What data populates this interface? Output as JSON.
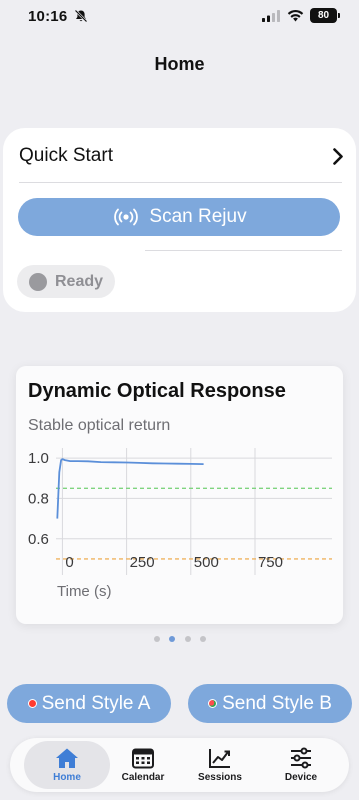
{
  "status_bar": {
    "time": "10:16",
    "battery": "80"
  },
  "header": {
    "title": "Home"
  },
  "quick_start": {
    "title": "Quick Start",
    "scan_button_label": "Scan Rejuv",
    "status": "Ready"
  },
  "chart_card": {
    "title": "Dynamic Optical Response",
    "subtitle": "Stable optical return"
  },
  "chart_data": {
    "type": "line",
    "title": "Dynamic Optical Response",
    "subtitle": "Stable optical return",
    "xlabel": "Time (s)",
    "ylabel": "",
    "xlim": [
      -25,
      1050
    ],
    "ylim": [
      0.45,
      1.05
    ],
    "x_ticks": [
      0,
      250,
      500,
      750
    ],
    "y_ticks": [
      0.6,
      0.8,
      1.0
    ],
    "x_tick_labels": [
      "0",
      "250",
      "500",
      "750"
    ],
    "y_tick_labels": [
      "0.6",
      "0.8",
      "1.0"
    ],
    "grid": true,
    "series": [
      {
        "color": "#5b8fd9",
        "x": [
          -20,
          -12,
          -5,
          0,
          10,
          30,
          60,
          100,
          150,
          200,
          250,
          300,
          350,
          400,
          450,
          500,
          550
        ],
        "y": [
          0.7,
          0.93,
          0.99,
          0.995,
          0.99,
          0.985,
          0.985,
          0.984,
          0.98,
          0.979,
          0.978,
          0.976,
          0.974,
          0.973,
          0.972,
          0.971,
          0.97
        ]
      }
    ],
    "reference_lines": [
      {
        "y": 0.85,
        "color": "#7fd47f",
        "style": "dashed"
      },
      {
        "y": 0.5,
        "color": "#f0b35f",
        "style": "dashed"
      }
    ]
  },
  "pagination": {
    "count": 4,
    "active": 1
  },
  "send_buttons": [
    {
      "label": "Send Style A",
      "dot_color": "#ff3b30"
    },
    {
      "label": "Send Style B",
      "dot_color": "#c0392b"
    }
  ],
  "tabs": [
    {
      "label": "Home",
      "icon": "home-icon",
      "active": true
    },
    {
      "label": "Calendar",
      "icon": "calendar-icon",
      "active": false
    },
    {
      "label": "Sessions",
      "icon": "chart-line-icon",
      "active": false
    },
    {
      "label": "Device",
      "icon": "sliders-icon",
      "active": false
    }
  ],
  "colors": {
    "accent": "#7ea8dc",
    "active_tab": "#3f7ed6"
  }
}
